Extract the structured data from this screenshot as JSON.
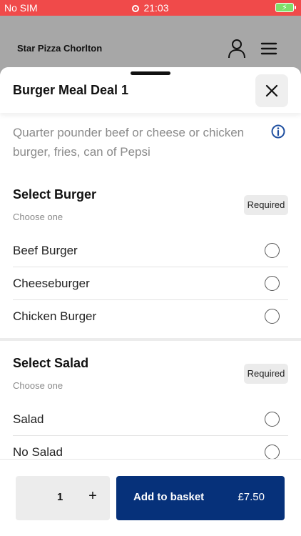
{
  "status_bar": {
    "carrier": "No SIM",
    "time": "21:03"
  },
  "header": {
    "shop_name": "Star Pizza Chorlton"
  },
  "sheet": {
    "title": "Burger Meal Deal 1",
    "description": "Quarter pounder beef or cheese or chicken burger, fries, can of Pepsi"
  },
  "groups": [
    {
      "title": "Select Burger",
      "subtitle": "Choose one",
      "badge": "Required",
      "options": [
        "Beef Burger",
        "Cheeseburger",
        "Chicken Burger"
      ]
    },
    {
      "title": "Select Salad",
      "subtitle": "Choose one",
      "badge": "Required",
      "options": [
        "Salad",
        "No Salad"
      ]
    }
  ],
  "footer": {
    "quantity": "1",
    "plus": "+",
    "add_label": "Add to basket",
    "price": "£7.50"
  },
  "colors": {
    "status_bar": "#f04a4a",
    "primary": "#06317a",
    "info": "#1f4fa0"
  }
}
